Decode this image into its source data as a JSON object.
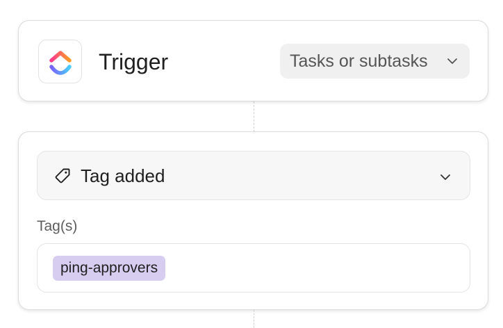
{
  "trigger": {
    "title": "Trigger",
    "scope_select": {
      "value": "Tasks or subtasks"
    }
  },
  "condition": {
    "event_select": {
      "value": "Tag added"
    },
    "tags_field": {
      "label": "Tag(s)",
      "selected_tags": [
        "ping-approvers"
      ]
    }
  },
  "icons": {
    "app_logo": "clickup-logo-icon",
    "scope_dropdown": "chevron-down-icon",
    "event_icon": "tag-icon",
    "event_dropdown": "chevron-down-icon"
  },
  "colors": {
    "tag_chip_bg": "#d6cdf0",
    "logo_pink": "#fa3a8b",
    "logo_orange": "#ff9b26",
    "logo_purple": "#7b61ff",
    "logo_blue": "#49ccf9"
  }
}
